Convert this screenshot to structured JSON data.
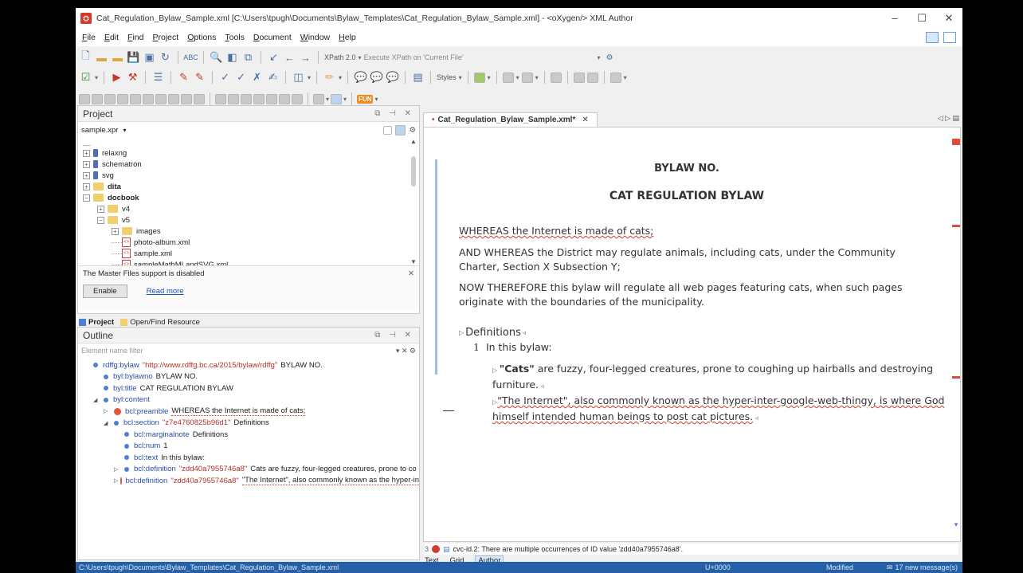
{
  "window": {
    "title": "Cat_Regulation_Bylaw_Sample.xml [C:\\Users\\tpugh\\Documents\\Bylaw_Templates\\Cat_Regulation_Bylaw_Sample.xml] - <oXygen/> XML Author",
    "minimize": "–",
    "maximize": "☐",
    "close": "✕"
  },
  "menu": [
    "File",
    "Edit",
    "Find",
    "Project",
    "Options",
    "Tools",
    "Document",
    "Window",
    "Help"
  ],
  "toolbar": {
    "xpath_version": "XPath 2.0",
    "xpath_placeholder": "Execute XPath on 'Current File'",
    "styles_label": "Styles",
    "fun_label": "FUN"
  },
  "project": {
    "title": "Project",
    "file": "sample.xpr",
    "tree": [
      {
        "label": "relaxng",
        "type": "folder-blue",
        "indent": 0,
        "bold": false,
        "exp": "+"
      },
      {
        "label": "schematron",
        "type": "folder-blue",
        "indent": 0,
        "bold": false,
        "exp": "+"
      },
      {
        "label": "svg",
        "type": "folder-blue",
        "indent": 0,
        "bold": false,
        "exp": "+"
      },
      {
        "label": "dita",
        "type": "folder",
        "indent": 0,
        "bold": true,
        "exp": "+"
      },
      {
        "label": "docbook",
        "type": "folder",
        "indent": 0,
        "bold": true,
        "exp": "−"
      },
      {
        "label": "v4",
        "type": "folder",
        "indent": 1,
        "bold": false,
        "exp": "+"
      },
      {
        "label": "v5",
        "type": "folder",
        "indent": 1,
        "bold": false,
        "exp": "−"
      },
      {
        "label": "images",
        "type": "folder",
        "indent": 2,
        "bold": false,
        "exp": "+"
      },
      {
        "label": "photo-album.xml",
        "type": "xml",
        "indent": 2,
        "bold": false,
        "exp": ""
      },
      {
        "label": "sample.xml",
        "type": "xml",
        "indent": 2,
        "bold": false,
        "exp": ""
      },
      {
        "label": "sampleMathMLandSVG.xml",
        "type": "xml",
        "indent": 2,
        "bold": false,
        "exp": ""
      }
    ],
    "master_files_msg": "The Master Files support is disabled",
    "enable_label": "Enable",
    "read_more_label": "Read more",
    "tab_project": "Project",
    "tab_openfind": "Open/Find Resource"
  },
  "outline": {
    "title": "Outline",
    "filter_placeholder": "Element name filter",
    "rows": [
      {
        "indent": 0,
        "tag": "rdffg:bylaw",
        "attr": "\"http://www.rdffg.bc.ca/2015/bylaw/rdffg\"",
        "text": "BYLAW NO.",
        "warn": false,
        "exp": ""
      },
      {
        "indent": 1,
        "tag": "byl:bylawno",
        "attr": "",
        "text": "BYLAW NO.",
        "warn": false,
        "exp": ""
      },
      {
        "indent": 1,
        "tag": "byl:title",
        "attr": "",
        "text": "CAT REGULATION BYLAW",
        "warn": false,
        "exp": ""
      },
      {
        "indent": 1,
        "tag": "byl:content",
        "attr": "",
        "text": "",
        "warn": false,
        "exp": "◢"
      },
      {
        "indent": 2,
        "tag": "bcl:preamble",
        "attr": "",
        "text": "WHEREAS the Internet is made of cats;",
        "warn": true,
        "exp": "▷"
      },
      {
        "indent": 2,
        "tag": "bcl:section",
        "attr": "\"z7e4760825b96d1\"",
        "text": "Definitions",
        "warn": false,
        "exp": "◢"
      },
      {
        "indent": 3,
        "tag": "bcl:marginalnote",
        "attr": "",
        "text": "Definitions",
        "warn": false,
        "exp": ""
      },
      {
        "indent": 3,
        "tag": "bcl:num",
        "attr": "",
        "text": "1",
        "warn": false,
        "exp": ""
      },
      {
        "indent": 3,
        "tag": "bcl:text",
        "attr": "",
        "text": "In this bylaw:",
        "warn": false,
        "exp": ""
      },
      {
        "indent": 3,
        "tag": "bcl:definition",
        "attr": "\"zdd40a7955746a8\"",
        "text": "Cats are fuzzy, four-legged creatures, prone to co",
        "warn": false,
        "exp": "▷"
      },
      {
        "indent": 3,
        "tag": "bcl:definition",
        "attr": "\"zdd40a7955746a8\"",
        "text": "\"The Internet\", also commonly known as the hyper-in",
        "warn": true,
        "exp": "▷"
      }
    ]
  },
  "editor": {
    "tab_label": "Cat_Regulation_Bylaw_Sample.xml*",
    "bylaw_no": "BYLAW NO.",
    "title": "CAT REGULATION BYLAW",
    "p1": "WHEREAS the Internet is made of cats;",
    "p2": "AND WHEREAS the District may regulate animals, including cats, under the Community Charter, Section X Subsection Y;",
    "p3": "NOW THEREFORE this bylaw will regulate all web pages featuring cats, when such pages originate with the boundaries of the municipality.",
    "section_heading": "Definitions",
    "section_num": "1",
    "section_text": "In this bylaw:",
    "def1_term": "\"Cats\"",
    "def1_text": " are fuzzy, four-legged creatures, prone to coughing up hairballs and destroying furniture.",
    "def2_text": "\"The Internet\", also commonly known as the hyper-inter-google-web-thingy, is where God himself intended human beings to post cat pictures.",
    "problem_msg": "cvc-id.2: There are multiple occurrences of ID value 'zdd40a7955746a8'.",
    "mode_tabs": [
      "Text",
      "Grid",
      "Author"
    ],
    "problem_count": "3"
  },
  "status": {
    "path": "C:\\Users\\tpugh\\Documents\\Bylaw_Templates\\Cat_Regulation_Bylaw_Sample.xml",
    "unicode": "U+0000",
    "modified": "Modified",
    "messages": "17 new message(s)"
  }
}
